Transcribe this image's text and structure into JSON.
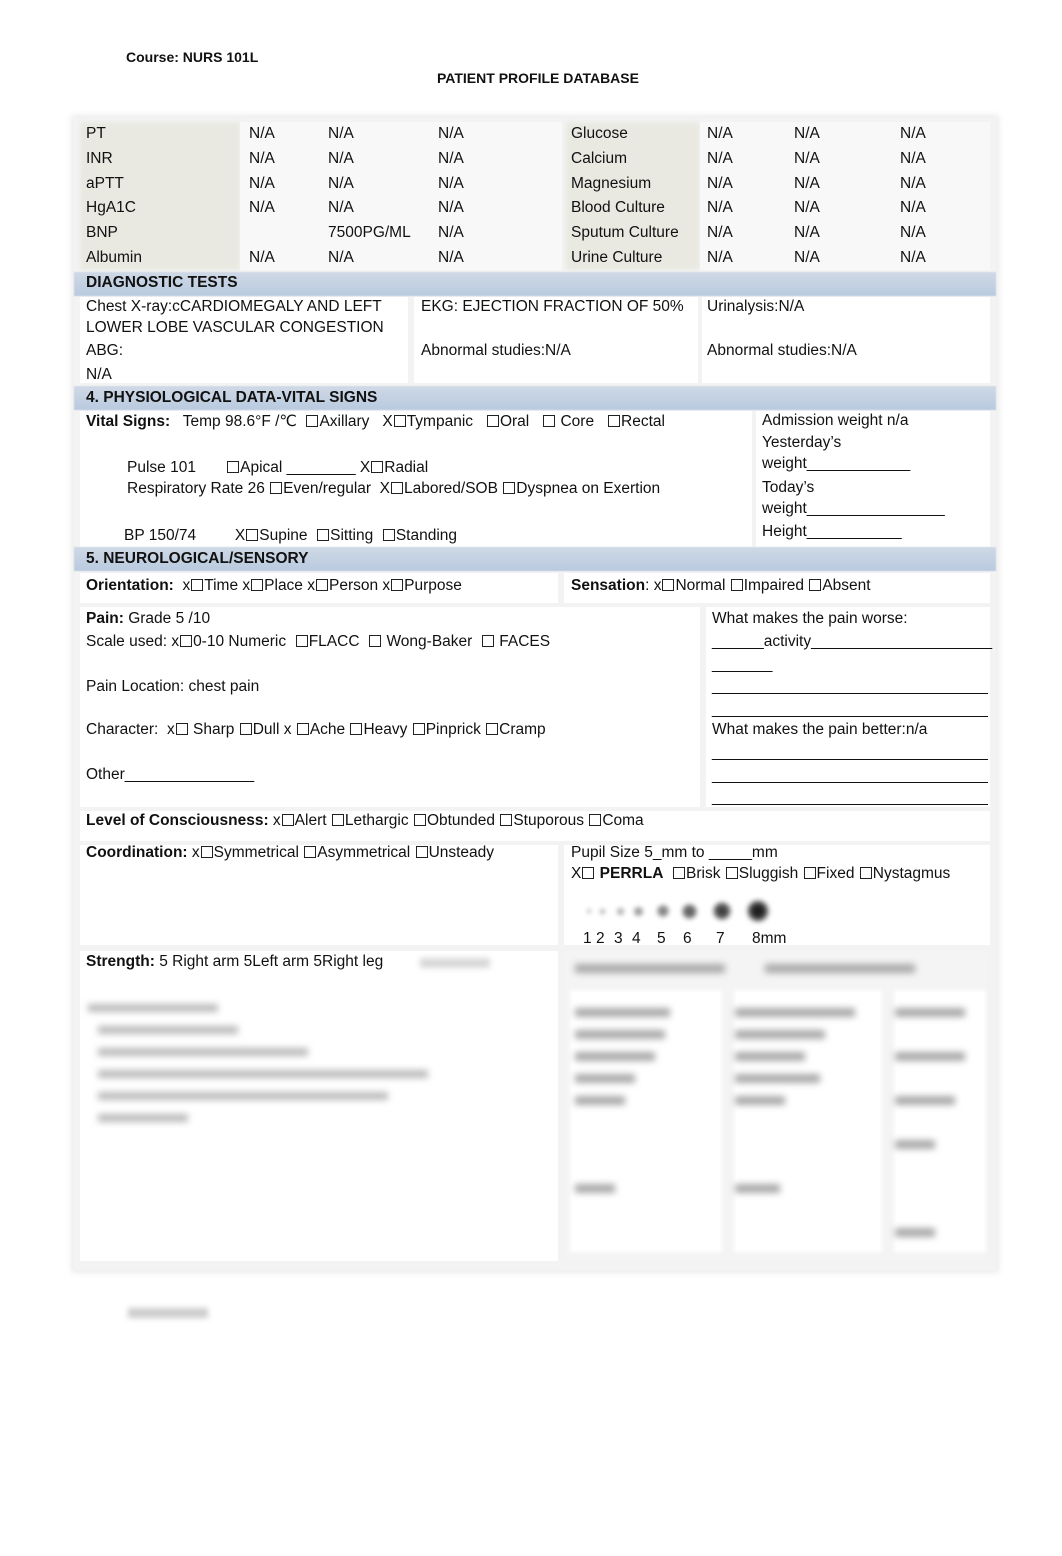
{
  "header": {
    "course": "Course: NURS 101L",
    "title": "PATIENT PROFILE DATABASE"
  },
  "labs": {
    "left": [
      {
        "name": "PT",
        "v1": "N/A",
        "v2": "N/A",
        "v3": "N/A"
      },
      {
        "name": "INR",
        "v1": "N/A",
        "v2": "N/A",
        "v3": "N/A"
      },
      {
        "name": "aPTT",
        "v1": "N/A",
        "v2": "N/A",
        "v3": "N/A"
      },
      {
        "name": "HgA1C",
        "v1": "N/A",
        "v2": "N/A",
        "v3": "N/A"
      },
      {
        "name": "BNP",
        "v1": "",
        "v2": "7500PG/ML",
        "v3": "N/A"
      },
      {
        "name": "Albumin",
        "v1": "N/A",
        "v2": "N/A",
        "v3": "N/A"
      }
    ],
    "right": [
      {
        "name": "Glucose",
        "v1": "N/A",
        "v2": "N/A",
        "v3": "N/A"
      },
      {
        "name": "Calcium",
        "v1": "N/A",
        "v2": "N/A",
        "v3": "N/A"
      },
      {
        "name": "Magnesium",
        "v1": "N/A",
        "v2": "N/A",
        "v3": "N/A"
      },
      {
        "name": "Blood Culture",
        "v1": "N/A",
        "v2": "N/A",
        "v3": "N/A"
      },
      {
        "name": "Sputum Culture",
        "v1": "N/A",
        "v2": "N/A",
        "v3": "N/A"
      },
      {
        "name": "Urine Culture",
        "v1": "N/A",
        "v2": "N/A",
        "v3": "N/A"
      }
    ]
  },
  "diagnostics": {
    "heading": "DIAGNOSTIC TESTS",
    "chest_xray_line1": "Chest X-ray:cCARDIOMEGALY AND LEFT",
    "chest_xray_line2": "LOWER LOBE VASCULAR CONGESTION",
    "ekg": "EKG: EJECTION FRACTION OF 50%",
    "urinalysis": "Urinalysis:N/A",
    "abg_label": "ABG:",
    "abg_value": "N/A",
    "abnormal_1": "Abnormal studies:N/A",
    "abnormal_2": "Abnormal studies:N/A"
  },
  "vitals": {
    "heading": "4. PHYSIOLOGICAL DATA-VITAL SIGNS",
    "label": "Vital Signs:",
    "temp": "Temp 98.6°F /℃",
    "temp_sites": [
      {
        "mark": "",
        "label": "Axillary"
      },
      {
        "mark": "X",
        "label": "Tympanic"
      },
      {
        "mark": "",
        "label": "Oral"
      },
      {
        "mark": "",
        "label": " Core"
      },
      {
        "mark": "",
        "label": "Rectal"
      }
    ],
    "pulse": "Pulse 101",
    "pulse_sites": [
      {
        "mark": "",
        "label": "Apical ________ "
      },
      {
        "mark": "X",
        "label": "Radial"
      }
    ],
    "resp": "Respiratory Rate 26",
    "resp_opts": [
      {
        "mark": "",
        "label": "Even/regular "
      },
      {
        "mark": "X",
        "label": "Labored/SOB"
      },
      {
        "mark": "",
        "label": "Dyspnea on Exertion"
      }
    ],
    "bp": "BP 150/74",
    "bp_opts": [
      {
        "mark": "X",
        "label": "Supine"
      },
      {
        "mark": "",
        "label": "Sitting"
      },
      {
        "mark": "",
        "label": "Standing"
      }
    ],
    "admission_weight": "Admission weight n/a",
    "yesterday_1": "Yesterday’s",
    "yesterday_2": "weight____________",
    "today_1": "Today’s",
    "today_2": "weight________________",
    "height": "Height___________"
  },
  "neuro": {
    "heading": "5. NEUROLOGICAL/SENSORY",
    "orientation_label": "Orientation:",
    "orientation": [
      {
        "mark": "x",
        "label": "Time "
      },
      {
        "mark": "x",
        "label": "Place "
      },
      {
        "mark": "x",
        "label": "Person "
      },
      {
        "mark": "x",
        "label": "Purpose"
      }
    ],
    "sensation_label": "Sensation",
    "sensation": [
      {
        "mark": "x",
        "label": "Normal "
      },
      {
        "mark": "",
        "label": "Impaired "
      },
      {
        "mark": "",
        "label": "Absent"
      }
    ],
    "pain_label": "Pain:",
    "pain_grade": "Grade 5 /10",
    "scale_label": "Scale used:",
    "scale": [
      {
        "mark": "x",
        "label": "0-10 Numeric "
      },
      {
        "mark": "",
        "label": "FLACC "
      },
      {
        "mark": "",
        "label": " Wong-Baker "
      },
      {
        "mark": "",
        "label": " FACES"
      }
    ],
    "pain_location": "Pain Location: chest pain",
    "character_label": "Character:",
    "character": [
      {
        "mark": "x",
        "label": " Sharp "
      },
      {
        "mark": "",
        "label": "Dull x "
      },
      {
        "mark": "",
        "label": "Ache "
      },
      {
        "mark": "",
        "label": "Heavy "
      },
      {
        "mark": "",
        "label": "Pinprick "
      },
      {
        "mark": "",
        "label": "Cramp"
      }
    ],
    "other": "Other_______________",
    "worse_label": "What makes the pain worse:",
    "worse_lines": [
      "______activity_____________________",
      "_______",
      "________________________________",
      "________________________________"
    ],
    "better_label": "What makes the pain better:n/a",
    "better_lines": [
      "________________________________",
      "________________________________",
      "________________________________"
    ],
    "loc_label": "Level of Consciousness:",
    "loc": [
      {
        "mark": "x",
        "label": "Alert "
      },
      {
        "mark": "",
        "label": "Lethargic "
      },
      {
        "mark": "",
        "label": "Obtunded "
      },
      {
        "mark": "",
        "label": "Stuporous "
      },
      {
        "mark": "",
        "label": "Coma"
      }
    ],
    "coord_label": "Coordination:",
    "coord": [
      {
        "mark": "x",
        "label": "Symmetrical "
      },
      {
        "mark": "",
        "label": "Asymmetrical "
      },
      {
        "mark": "",
        "label": "Unsteady"
      }
    ],
    "pupil_size": "Pupil Size  5_mm to _____mm",
    "pupil_opts_mark": "X",
    "perrla": "PERRLA",
    "pupil_opts": [
      {
        "mark": "",
        "label": "Brisk "
      },
      {
        "mark": "",
        "label": "Sluggish "
      },
      {
        "mark": "",
        "label": "Fixed "
      },
      {
        "mark": "",
        "label": "Nystagmus"
      }
    ],
    "pupil_scale": [
      "1",
      "2",
      "3",
      "4",
      "5",
      "6",
      "7",
      "8mm"
    ],
    "strength_label": "Strength:",
    "strength": "5 Right arm  5Left arm  5Right leg"
  }
}
